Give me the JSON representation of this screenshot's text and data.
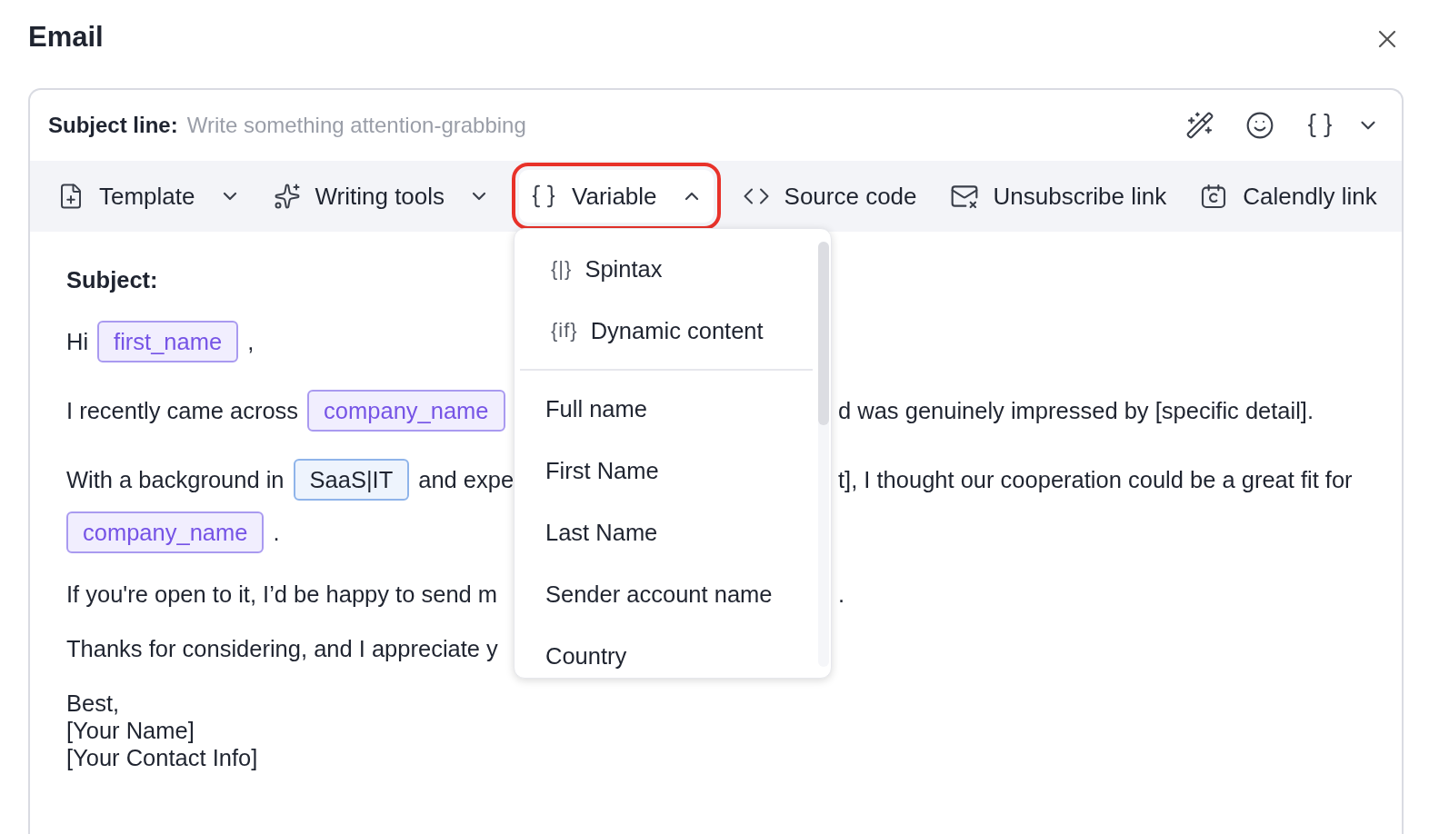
{
  "dialog": {
    "title": "Email"
  },
  "subject_line": {
    "label": "Subject line:",
    "placeholder": "Write something attention-grabbing"
  },
  "toolbar": [
    {
      "kind": "template",
      "label": "Template",
      "dropdown": true,
      "selected": false,
      "highlighted": false
    },
    {
      "kind": "writing",
      "label": "Writing tools",
      "dropdown": true,
      "selected": false,
      "highlighted": false
    },
    {
      "kind": "variable",
      "label": "Variable",
      "dropdown": true,
      "selected": true,
      "highlighted": true
    },
    {
      "kind": "code",
      "label": "Source code",
      "dropdown": false,
      "selected": false,
      "highlighted": false
    },
    {
      "kind": "unsubscribe",
      "label": "Unsubscribe link",
      "dropdown": false,
      "selected": false,
      "highlighted": false
    },
    {
      "kind": "calendly",
      "label": "Calendly link",
      "dropdown": false,
      "selected": false,
      "highlighted": false
    }
  ],
  "variable_menu": {
    "special": [
      {
        "icon": "{|}",
        "label": "Spintax"
      },
      {
        "icon": "{if}",
        "label": "Dynamic content"
      }
    ],
    "items": [
      "Full name",
      "First Name",
      "Last Name",
      "Sender account name",
      "Country"
    ]
  },
  "body": [
    {
      "lines": [
        {
          "left": [
            {
              "kind": "label",
              "text": "Subject:"
            }
          ]
        }
      ]
    },
    {
      "lines": [
        {
          "left": [
            {
              "kind": "text",
              "text": "Hi"
            },
            {
              "kind": "variable",
              "text": "first_name"
            },
            {
              "kind": "text",
              "text": ","
            }
          ]
        }
      ]
    },
    {
      "lines": [
        {
          "left": [
            {
              "kind": "text",
              "text": "I recently came across"
            },
            {
              "kind": "variable",
              "text": "company_name"
            }
          ],
          "right": "d was genuinely impressed by [specific detail]."
        }
      ]
    },
    {
      "lines": [
        {
          "left": [
            {
              "kind": "text",
              "text": "With a background in"
            },
            {
              "kind": "value",
              "text": "SaaS|IT"
            },
            {
              "kind": "text",
              "text": "and expe"
            }
          ],
          "right": "t], I thought our cooperation could be a great fit for"
        },
        {
          "left": [
            {
              "kind": "variable",
              "text": "company_name"
            },
            {
              "kind": "text",
              "text": "."
            }
          ]
        }
      ]
    },
    {
      "lines": [
        {
          "left": [
            {
              "kind": "text",
              "text": "If you're open to it, I’d be happy to send m"
            }
          ],
          "right": "."
        }
      ]
    },
    {
      "lines": [
        {
          "left": [
            {
              "kind": "text",
              "text": "Thanks for considering, and I appreciate y"
            }
          ]
        }
      ]
    },
    {
      "lines": [
        {
          "left": [
            {
              "kind": "text",
              "text": "Best,"
            }
          ]
        },
        {
          "left": [
            {
              "kind": "text",
              "text": "[Your Name]"
            }
          ]
        },
        {
          "left": [
            {
              "kind": "text",
              "text": "[Your Contact Info]"
            }
          ]
        }
      ]
    }
  ]
}
